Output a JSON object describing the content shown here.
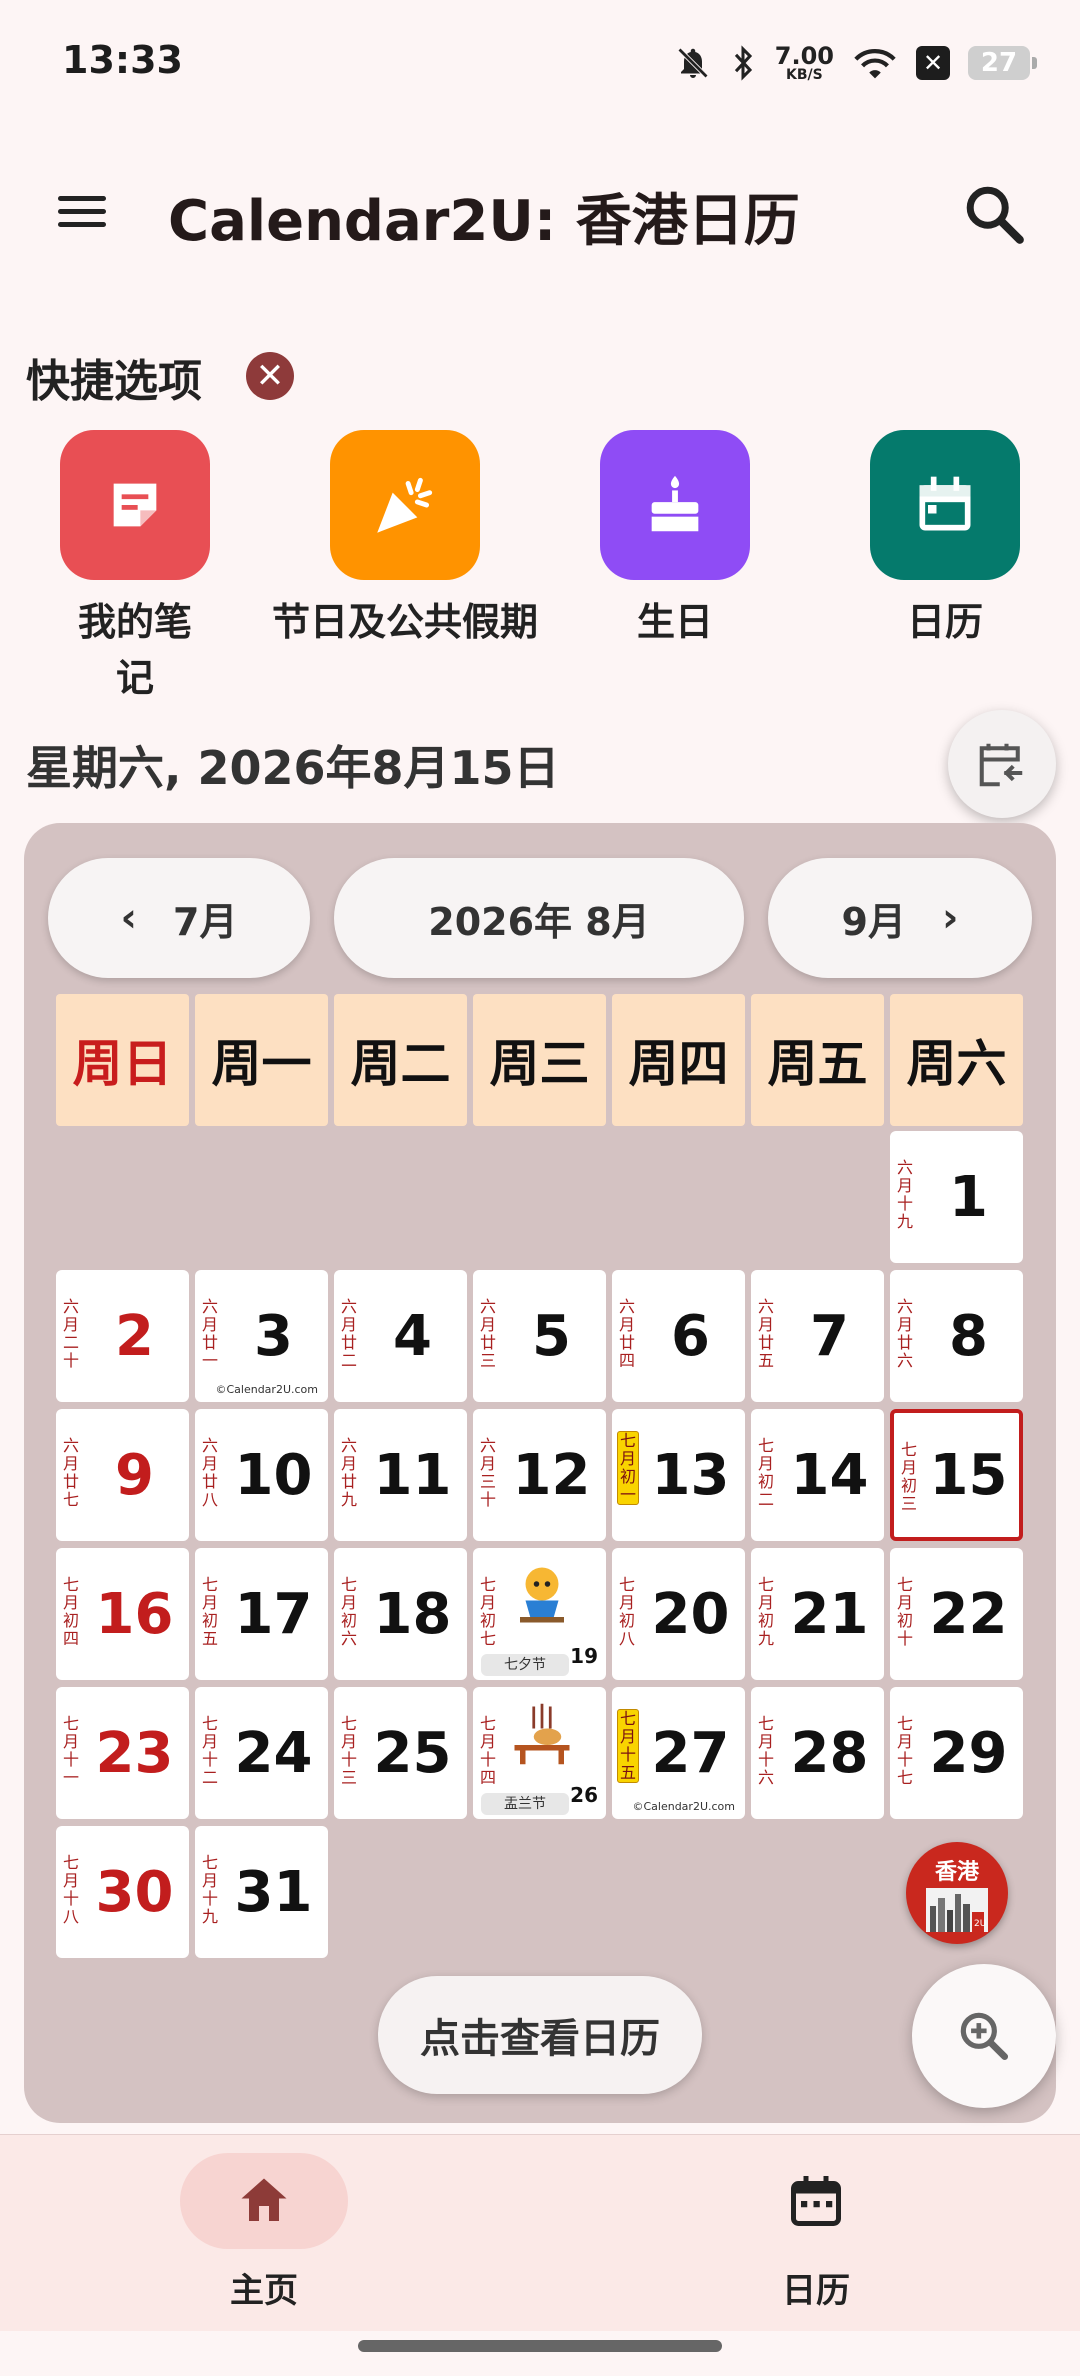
{
  "status_bar": {
    "time": "13:33",
    "net_speed": "7.00",
    "net_unit": "KB/S",
    "battery": "27",
    "xbox": "✕"
  },
  "app_bar": {
    "title": "Calendar2U: 香港日历",
    "menu_icon": "menu-icon",
    "search_icon": "search-icon"
  },
  "quick_options": {
    "title": "快捷选项",
    "close": "✕",
    "items": [
      {
        "label": "我的笔记",
        "icon": "note-icon",
        "color": "#e84f54"
      },
      {
        "label": "节日及公共假期",
        "icon": "party-icon",
        "color": "#ff9300"
      },
      {
        "label": "生日",
        "icon": "cake-icon",
        "color": "#8f4cf5"
      },
      {
        "label": "日历",
        "icon": "calendar-icon",
        "color": "#057a6c"
      }
    ]
  },
  "selected_date": "星期六, 2026年8月15日",
  "calendar": {
    "prev_month": "7月",
    "current": "2026年 8月",
    "next_month": "9月",
    "weekdays": [
      "周日",
      "周一",
      "周二",
      "周三",
      "周四",
      "周五",
      "周六"
    ],
    "days": [
      {
        "d": "1",
        "lunar": "六月十九"
      },
      {
        "d": "2",
        "lunar": "六月二十"
      },
      {
        "d": "3",
        "lunar": "六月廿一",
        "mark": "©Calendar2U.com"
      },
      {
        "d": "4",
        "lunar": "六月廿二"
      },
      {
        "d": "5",
        "lunar": "六月廿三"
      },
      {
        "d": "6",
        "lunar": "六月廿四"
      },
      {
        "d": "7",
        "lunar": "六月廿五"
      },
      {
        "d": "8",
        "lunar": "六月廿六"
      },
      {
        "d": "9",
        "lunar": "六月廿七"
      },
      {
        "d": "10",
        "lunar": "六月廿八"
      },
      {
        "d": "11",
        "lunar": "六月廿九"
      },
      {
        "d": "12",
        "lunar": "六月三十"
      },
      {
        "d": "13",
        "lunar": "七月初一"
      },
      {
        "d": "14",
        "lunar": "七月初二"
      },
      {
        "d": "15",
        "lunar": "七月初三"
      },
      {
        "d": "16",
        "lunar": "七月初四"
      },
      {
        "d": "17",
        "lunar": "七月初五"
      },
      {
        "d": "18",
        "lunar": "七月初六"
      },
      {
        "d": "19",
        "lunar": "七月初七",
        "festival": "七夕节"
      },
      {
        "d": "20",
        "lunar": "七月初八"
      },
      {
        "d": "21",
        "lunar": "七月初九"
      },
      {
        "d": "22",
        "lunar": "七月初十"
      },
      {
        "d": "23",
        "lunar": "七月十一"
      },
      {
        "d": "24",
        "lunar": "七月十二"
      },
      {
        "d": "25",
        "lunar": "七月十三"
      },
      {
        "d": "26",
        "lunar": "七月十四",
        "festival": "盂兰节"
      },
      {
        "d": "27",
        "lunar": "七月十五",
        "mark": "©Calendar2U.com"
      },
      {
        "d": "28",
        "lunar": "七月十六"
      },
      {
        "d": "29",
        "lunar": "七月十七"
      },
      {
        "d": "30",
        "lunar": "七月十八"
      },
      {
        "d": "31",
        "lunar": "七月十九"
      }
    ],
    "first_weekday_index": 6,
    "today": "15",
    "highlight_lunar_days": [
      "13",
      "27"
    ]
  },
  "hk_badge": {
    "line1": "香港",
    "line2": "2U"
  },
  "view_calendar_button": "点击查看日历",
  "bottom_nav": {
    "home": "主页",
    "calendar": "日历"
  },
  "colors": {
    "accent": "#c21d1d",
    "panel": "#d4c2c2",
    "weekday_bg": "#fde0c2"
  }
}
